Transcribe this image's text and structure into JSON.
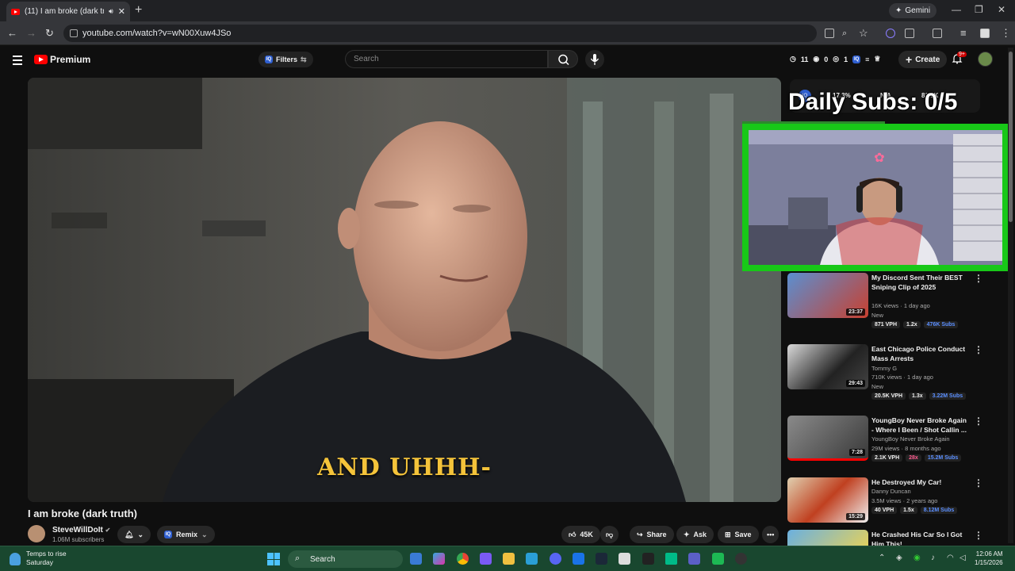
{
  "browser": {
    "tab_title": "(11) I am broke (dark truth)",
    "url": "youtube.com/watch?v=wN00Xuw4JSo",
    "gemini_label": "Gemini",
    "new_tab": "+"
  },
  "youtube": {
    "logo_text": "Premium",
    "filters_label": "Filters",
    "search_placeholder": "Search",
    "stats": {
      "s1": "11",
      "s2": "0",
      "s3": "1"
    },
    "create_label": "Create",
    "notif_badge": "9+"
  },
  "video": {
    "subtitle": "AND UHHH-",
    "title": "I am broke (dark truth)",
    "channel": "SteveWillDoIt",
    "subscribers": "1.06M subscribers",
    "remix_label": "Remix",
    "likes": "45K",
    "share_label": "Share",
    "ask_label": "Ask",
    "save_label": "Save"
  },
  "overlay": {
    "stat1": "17.3%",
    "stat2": "N/A",
    "stat3": "81.3K",
    "daily_subs": "Daily Subs: 0/5"
  },
  "recommendations": [
    {
      "title": "My Discord Sent Their BEST Sniping Clip of 2025",
      "channel": "",
      "meta": "16K views · 1 day ago",
      "badge": "New",
      "duration": "23:37",
      "vph": "871 VPH",
      "mult": "1.2x",
      "subs": "476K Subs"
    },
    {
      "title": "East Chicago Police Conduct Mass Arrests",
      "channel": "Tommy G",
      "meta": "710K views · 1 day ago",
      "badge": "New",
      "duration": "29:43",
      "vph": "20.5K VPH",
      "mult": "1.3x",
      "subs": "3.22M Subs"
    },
    {
      "title": "YoungBoy Never Broke Again - Where I Been / Shot Callin ...",
      "channel": "YoungBoy Never Broke Again",
      "meta": "29M views · 8 months ago",
      "badge": "",
      "duration": "7:28",
      "vph": "2.1K VPH",
      "mult": "28x",
      "subs": "15.2M Subs"
    },
    {
      "title": "He Destroyed My Car!",
      "channel": "Danny Duncan",
      "meta": "3.5M views · 2 years ago",
      "badge": "",
      "duration": "15:29",
      "vph": "40 VPH",
      "mult": "1.5x",
      "subs": "8.12M Subs"
    },
    {
      "title": "He Crashed His Car So I Got Him This!",
      "channel": "",
      "meta": "",
      "badge": "",
      "duration": "",
      "vph": "",
      "mult": "",
      "subs": ""
    }
  ],
  "taskbar": {
    "weather_title": "Temps to rise",
    "weather_sub": "Saturday",
    "search_label": "Search",
    "time": "12:06 AM",
    "date": "1/15/2026"
  },
  "colors": {
    "accent_red": "#ff0000",
    "green_frame": "#18c818",
    "subtitle_yellow": "#f4c33a",
    "taskbar": "#19472f"
  }
}
